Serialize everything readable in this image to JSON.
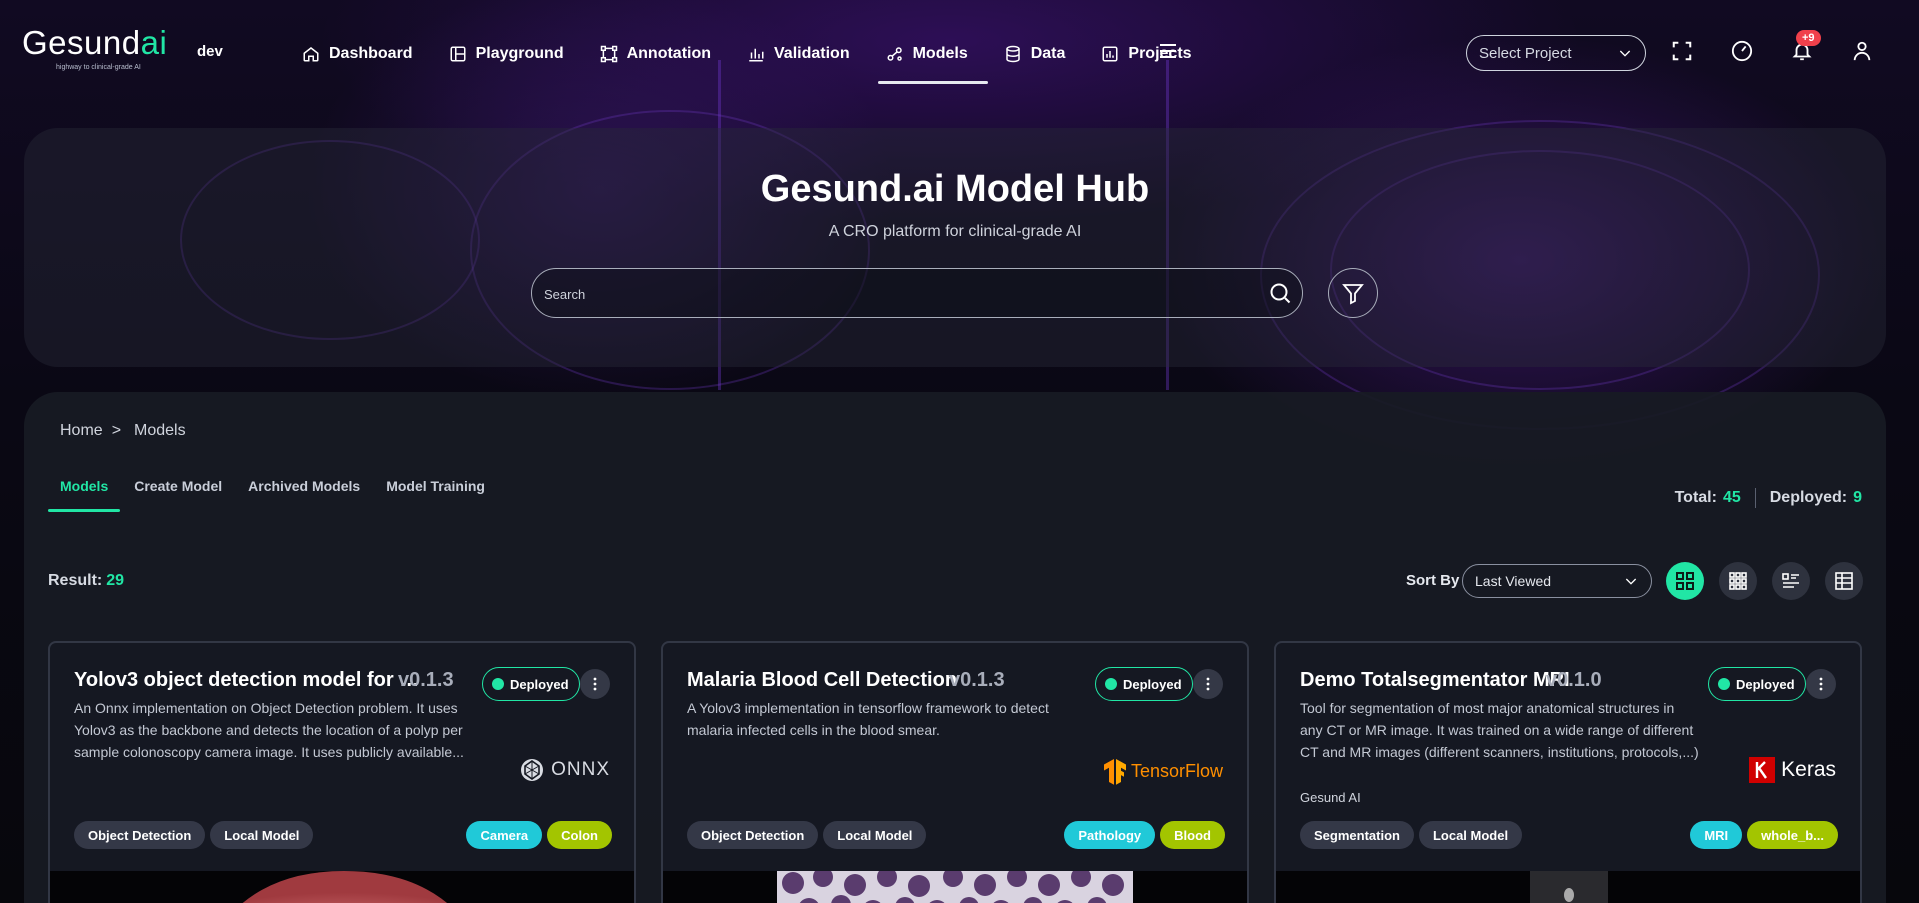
{
  "nav": {
    "logo_prefix": "Gesund",
    "logo_suffix": "ai",
    "logo_tagline": "highway to clinical-grade AI",
    "env": "dev",
    "items": [
      {
        "label": "Dashboard",
        "icon": "home-icon"
      },
      {
        "label": "Playground",
        "icon": "playground-icon"
      },
      {
        "label": "Annotation",
        "icon": "annotation-icon"
      },
      {
        "label": "Validation",
        "icon": "bar-chart-icon"
      },
      {
        "label": "Models",
        "icon": "models-icon",
        "active": true
      },
      {
        "label": "Data",
        "icon": "database-icon"
      },
      {
        "label": "Projects",
        "icon": "projects-icon"
      }
    ],
    "project_select": "Select Project",
    "notifications_badge": "+9"
  },
  "hero": {
    "title": "Gesund.ai Model Hub",
    "subtitle": "A CRO platform for clinical-grade AI",
    "search_placeholder": "Search"
  },
  "breadcrumb": {
    "home": "Home",
    "separator": ">",
    "current": "Models"
  },
  "tabs": [
    "Models",
    "Create Model",
    "Archived Models",
    "Model Training"
  ],
  "totals": {
    "total_label": "Total:",
    "total": "45",
    "deployed_label": "Deployed:",
    "deployed": "9"
  },
  "result": {
    "label": "Result:",
    "count": "29"
  },
  "sort": {
    "label": "Sort By",
    "value": "Last Viewed"
  },
  "colors": {
    "accent": "#21e6a5",
    "cyan_tag": "#20c9d8",
    "lime_tag": "#a3c500"
  },
  "cards": [
    {
      "title": "Yolov3 object detection model for K...",
      "version": "v0.1.3",
      "status": "Deployed",
      "description": "An Onnx implementation on Object Detection problem. It uses Yolov3 as the backbone and detects the location of a polyp per sample colonoscopy camera image. It uses publicly available...",
      "owner": "",
      "framework": "ONNX",
      "tags_left": [
        "Object Detection",
        "Local Model"
      ],
      "tags_right": [
        "Camera",
        "Colon"
      ]
    },
    {
      "title": "Malaria Blood Cell Detection",
      "version": "v0.1.3",
      "status": "Deployed",
      "description": "A Yolov3 implementation in tensorflow framework to detect malaria infected cells in the blood smear.",
      "owner": "",
      "framework": "TensorFlow",
      "tags_left": [
        "Object Detection",
        "Local Model"
      ],
      "tags_right": [
        "Pathology",
        "Blood"
      ]
    },
    {
      "title": "Demo Totalsegmentator MRI",
      "version": "v0.1.0",
      "status": "Deployed",
      "description": "Tool for segmentation of most major anatomical structures in any CT or MR image. It was trained on a wide range of different CT and MR images (different scanners, institutions, protocols,...)",
      "owner": "Gesund AI",
      "framework": "Keras",
      "tags_left": [
        "Segmentation",
        "Local Model"
      ],
      "tags_right": [
        "MRI",
        "whole_b..."
      ]
    }
  ]
}
